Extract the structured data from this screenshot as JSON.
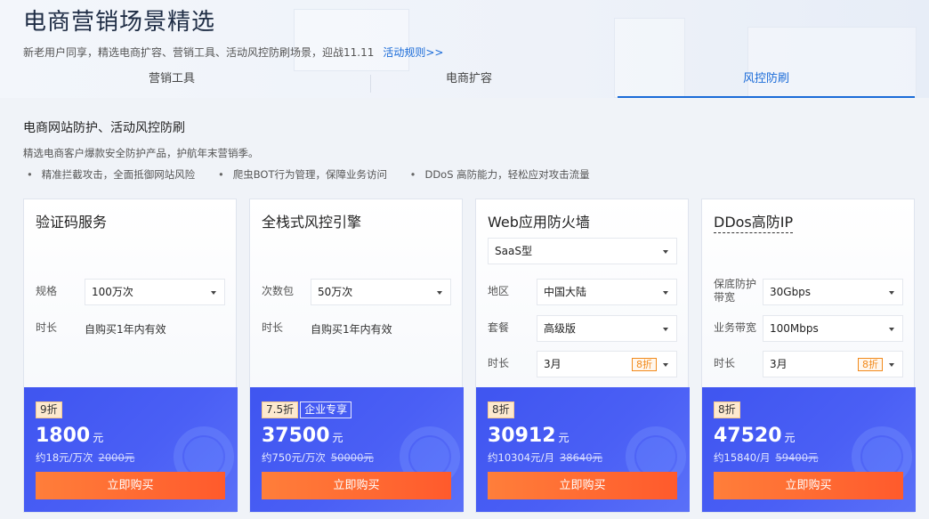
{
  "header": {
    "title": "电商营销场景精选",
    "subtitle": "新老用户同享，精选电商扩容、营销工具、活动风控防刷场景，迎战11.11",
    "rules_link": "活动规则>>"
  },
  "tabs": [
    {
      "label": "营销工具",
      "active": false
    },
    {
      "label": "电商扩容",
      "active": false
    },
    {
      "label": "风控防刷",
      "active": true
    }
  ],
  "section": {
    "title": "电商网站防护、活动风控防刷",
    "desc": "精选电商客户爆款安全防护产品，护航年末营销季。",
    "bullets": [
      "精准拦截攻击，全面抵御网站风险",
      "爬虫BOT行为管理，保障业务访问",
      "DDoS 高防能力，轻松应对攻击流量"
    ]
  },
  "cards": [
    {
      "title": "验证码服务",
      "spec_label": "规格",
      "spec_value": "100万次",
      "duration_label": "时长",
      "duration_value": "自购买1年内有效",
      "badge": "9折",
      "price": "1800",
      "unit": "元",
      "per": "约18元/万次",
      "original": "2000元",
      "buy": "立即购买"
    },
    {
      "title": "全栈式风控引擎",
      "spec_label": "次数包",
      "spec_value": "50万次",
      "duration_label": "时长",
      "duration_value": "自购买1年内有效",
      "badge": "7.5折",
      "badge2": "企业专享",
      "price": "37500",
      "unit": "元",
      "per": "约750元/万次",
      "original": "50000元",
      "buy": "立即购买"
    },
    {
      "title": "Web应用防火墙",
      "type_value": "SaaS型",
      "region_label": "地区",
      "region_value": "中国大陆",
      "plan_label": "套餐",
      "plan_value": "高级版",
      "duration_label": "时长",
      "duration_value": "3月",
      "duration_discount": "8折",
      "badge": "8折",
      "price": "30912",
      "unit": "元",
      "per": "约10304元/月",
      "original": "38640元",
      "buy": "立即购买"
    },
    {
      "title": "DDos高防IP",
      "protect_label": "保底防护带宽",
      "protect_value": "30Gbps",
      "bandwidth_label": "业务带宽",
      "bandwidth_value": "100Mbps",
      "duration_label": "时长",
      "duration_value": "3月",
      "duration_discount": "8折",
      "badge": "8折",
      "price": "47520",
      "unit": "元",
      "per": "约15840/月",
      "original": "59400元",
      "buy": "立即购买"
    }
  ]
}
